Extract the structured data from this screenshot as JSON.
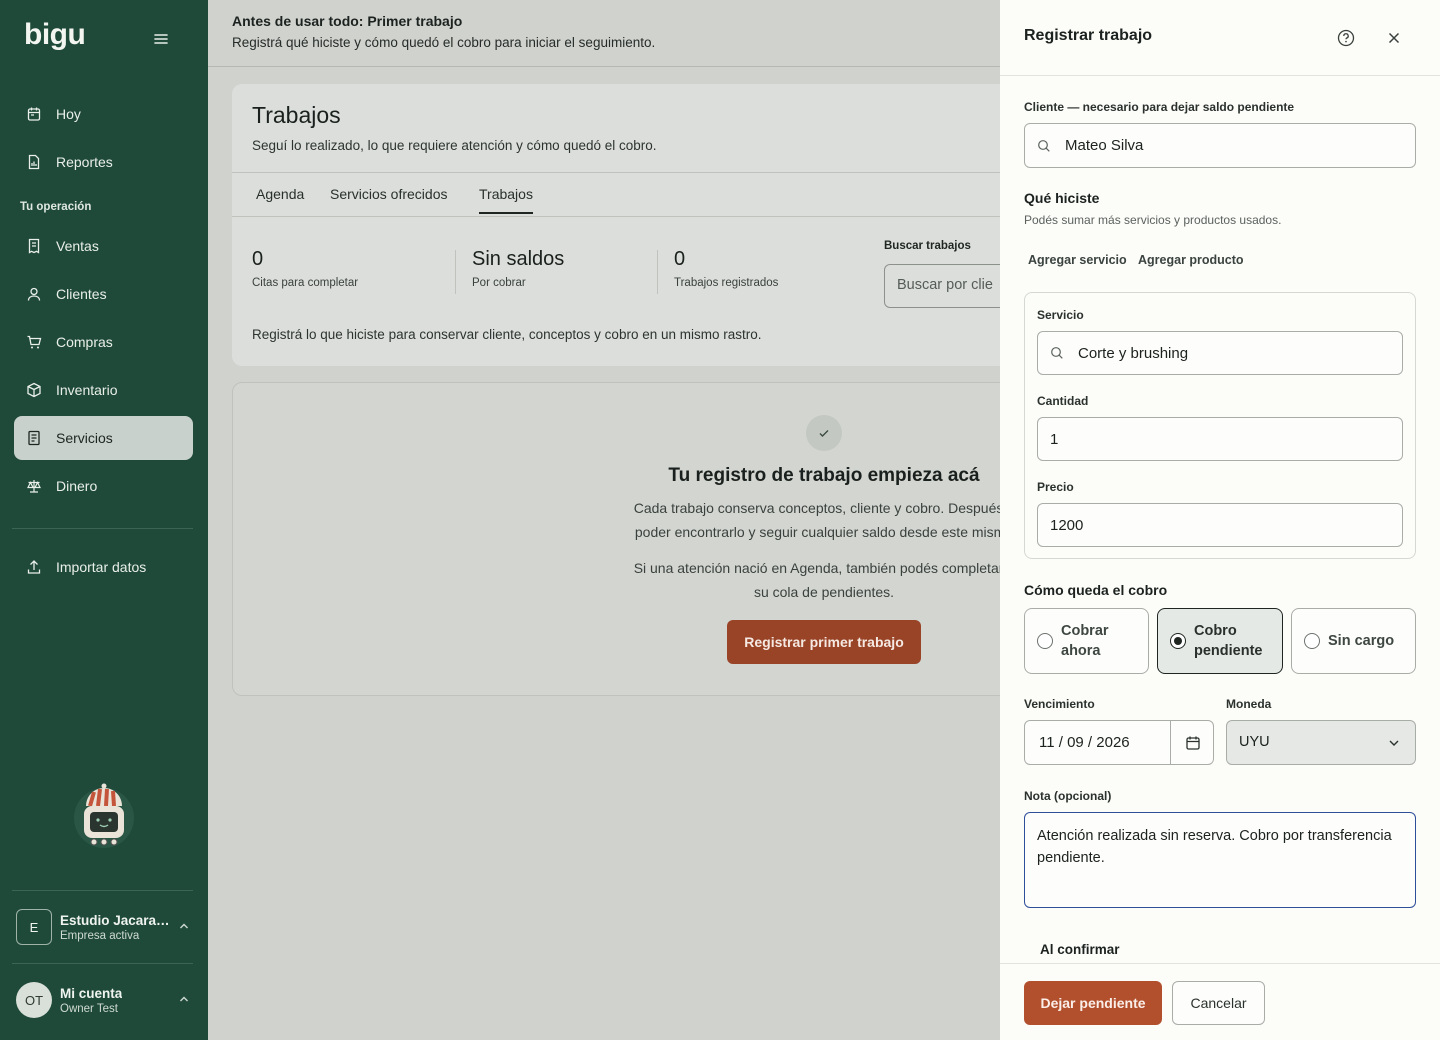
{
  "app": {
    "brand": "bigu"
  },
  "sidebar": {
    "items_top": [
      {
        "label": "Hoy",
        "icon": "calendar-icon"
      },
      {
        "label": "Reportes",
        "icon": "report-icon"
      }
    ],
    "section_label": "Tu operación",
    "items": [
      {
        "label": "Ventas",
        "icon": "receipt-icon"
      },
      {
        "label": "Clientes",
        "icon": "user-icon"
      },
      {
        "label": "Compras",
        "icon": "cart-icon"
      },
      {
        "label": "Inventario",
        "icon": "box-icon"
      },
      {
        "label": "Servicios",
        "icon": "document-icon",
        "active": true
      },
      {
        "label": "Dinero",
        "icon": "scale-icon"
      }
    ],
    "import_label": "Importar datos",
    "company": {
      "initial": "E",
      "name": "Estudio Jacaranda",
      "status": "Empresa activa"
    },
    "account": {
      "initials": "OT",
      "name": "Mi cuenta",
      "role": "Owner Test"
    }
  },
  "banner": {
    "title": "Antes de usar todo: Primer trabajo",
    "subtitle": "Registrá qué hiciste y cómo quedó el cobro para iniciar el seguimiento."
  },
  "page": {
    "title": "Trabajos",
    "subtitle": "Seguí lo realizado, lo que requiere atención y cómo quedó el cobro.",
    "tabs": [
      "Agenda",
      "Servicios ofrecidos",
      "Trabajos"
    ],
    "active_tab": "Trabajos",
    "stats": [
      {
        "value": "0",
        "label": "Citas para completar"
      },
      {
        "value": "Sin saldos",
        "label": "Por cobrar"
      },
      {
        "value": "0",
        "label": "Trabajos registrados"
      }
    ],
    "search": {
      "label": "Buscar trabajos",
      "placeholder": "Buscar por clie"
    },
    "note": "Registrá lo que hiciste para conservar cliente, conceptos y cobro en un mismo rastro."
  },
  "empty_state": {
    "title": "Tu registro de trabajo empieza acá",
    "line1": "Cada trabajo conserva conceptos, cliente y cobro. Después v",
    "line2": "poder encontrarlo y seguir cualquier saldo desde este mismo",
    "line3": "Si una atención nació en Agenda, también podés completarla",
    "line4": "su cola de pendientes.",
    "cta": "Registrar primer trabajo"
  },
  "drawer": {
    "title": "Registrar trabajo",
    "client_label": "Cliente — necesario para dejar saldo pendiente",
    "client_value": "Mateo Silva",
    "what_title": "Qué hiciste",
    "what_sub": "Podés sumar más servicios y productos usados.",
    "add_service": "Agregar servicio",
    "add_product": "Agregar producto",
    "service_label": "Servicio",
    "service_value": "Corte y brushing",
    "quantity_label": "Cantidad",
    "quantity_value": "1",
    "price_label": "Precio",
    "price_value": "1200",
    "payment_title": "Cómo queda el cobro",
    "payment_options": [
      {
        "line1": "Cobrar",
        "line2": "ahora",
        "selected": false
      },
      {
        "line1": "Cobro",
        "line2": "pendiente",
        "selected": true
      },
      {
        "line1": "Sin cargo",
        "line2": "",
        "selected": false
      }
    ],
    "due_label": "Vencimiento",
    "due_value": "11 / 09 / 2026",
    "currency_label": "Moneda",
    "currency_value": "UYU",
    "note_label": "Nota (opcional)",
    "note_value": "Atención realizada sin reserva. Cobro por transferencia pendiente.",
    "confirm_label": "Al confirmar",
    "primary_button": "Dejar pendiente",
    "secondary_button": "Cancelar"
  },
  "colors": {
    "sidebar_bg": "#1f4a3a",
    "accent": "#b2502e",
    "focus": "#2e4f9a"
  }
}
